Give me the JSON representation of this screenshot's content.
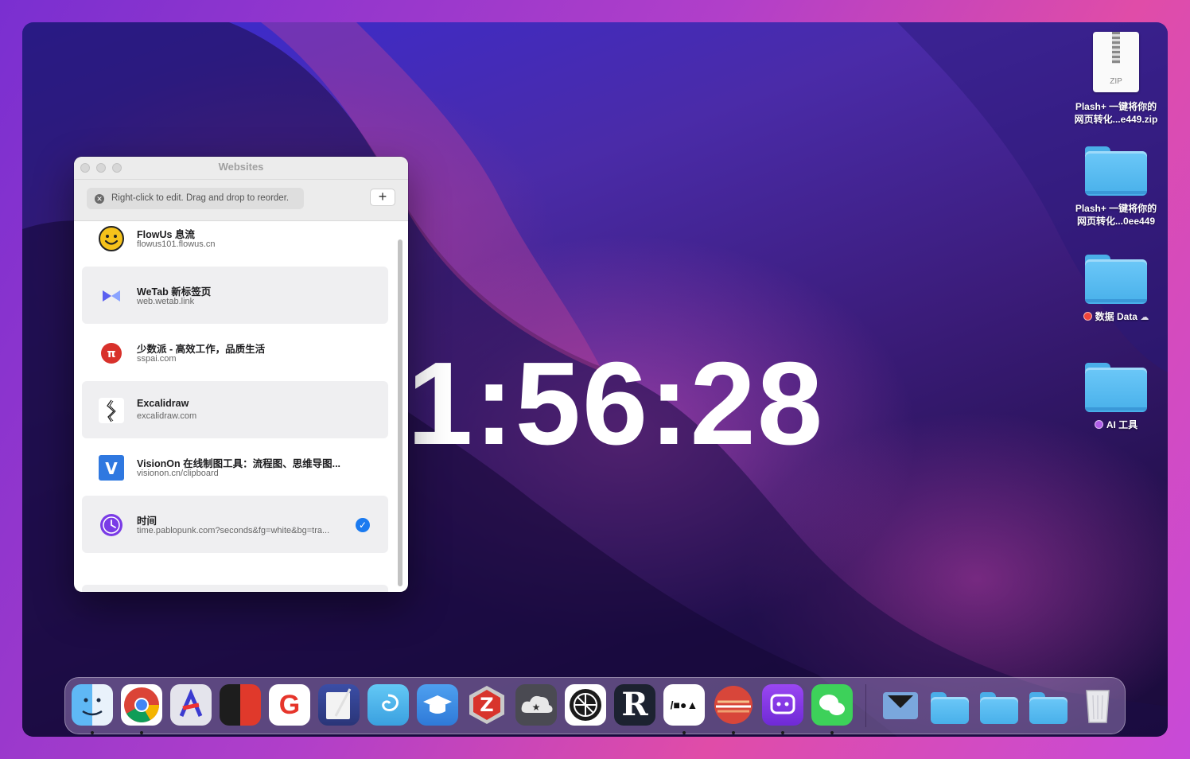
{
  "clock": {
    "time": "1:56:28"
  },
  "window": {
    "title": "Websites",
    "hint": "Right-click to edit. Drag and drop to reorder.",
    "add_label": "+",
    "sites": [
      {
        "name": "FlowUs 息流",
        "url": "flowus101.flowus.cn",
        "icon": "smiley-icon",
        "selected": false
      },
      {
        "name": "WeTab 新标签页",
        "url": "web.wetab.link",
        "icon": "wetab-icon",
        "selected": false
      },
      {
        "name": "少数派 - 高效工作，品质生活",
        "url": "sspai.com",
        "icon": "sspai-icon",
        "selected": false
      },
      {
        "name": "Excalidraw",
        "url": "excalidraw.com",
        "icon": "excalidraw-icon",
        "selected": false
      },
      {
        "name": "VisionOn 在线制图工具：流程图、思维导图...",
        "url": "visionon.cn/clipboard",
        "icon": "visionon-icon",
        "selected": false
      },
      {
        "name": "时间",
        "url": "time.pablopunk.com?seconds&fg=white&bg=tra...",
        "icon": "clock-icon",
        "selected": true
      }
    ]
  },
  "desktop": {
    "items": [
      {
        "kind": "zip",
        "label_line1": "Plash+ 一键将你的",
        "label_line2": "网页转化...e449.zip",
        "zip_text": "ZIP"
      },
      {
        "kind": "folder",
        "label_line1": "Plash+ 一键将你的",
        "label_line2": "网页转化...0ee449"
      },
      {
        "kind": "folder",
        "label_line1": "数据 Data",
        "tag_color": "#f0453a",
        "cloud": true
      },
      {
        "kind": "folder",
        "label_line1": "AI 工具",
        "tag_color": "#b15ee8"
      }
    ]
  },
  "dock": {
    "apps": [
      "finder-icon",
      "chrome-icon",
      "astro-icon",
      "dashboard-icon",
      "gitmind-icon",
      "textedit-icon",
      "smartsnippets-icon",
      "classroom-icon",
      "zotero-icon",
      "cloudmounter-icon",
      "aperture-icon",
      "reeder-icon",
      "moa-icon",
      "sunrise-icon",
      "chatbot-icon",
      "wechat-icon"
    ],
    "stack": [
      "inbox-icon",
      "folder-icon",
      "folder-icon",
      "folder-icon",
      "trash-icon"
    ],
    "colors": {
      "accent": "#1a7af0",
      "folder": "#5bbcf4"
    }
  }
}
